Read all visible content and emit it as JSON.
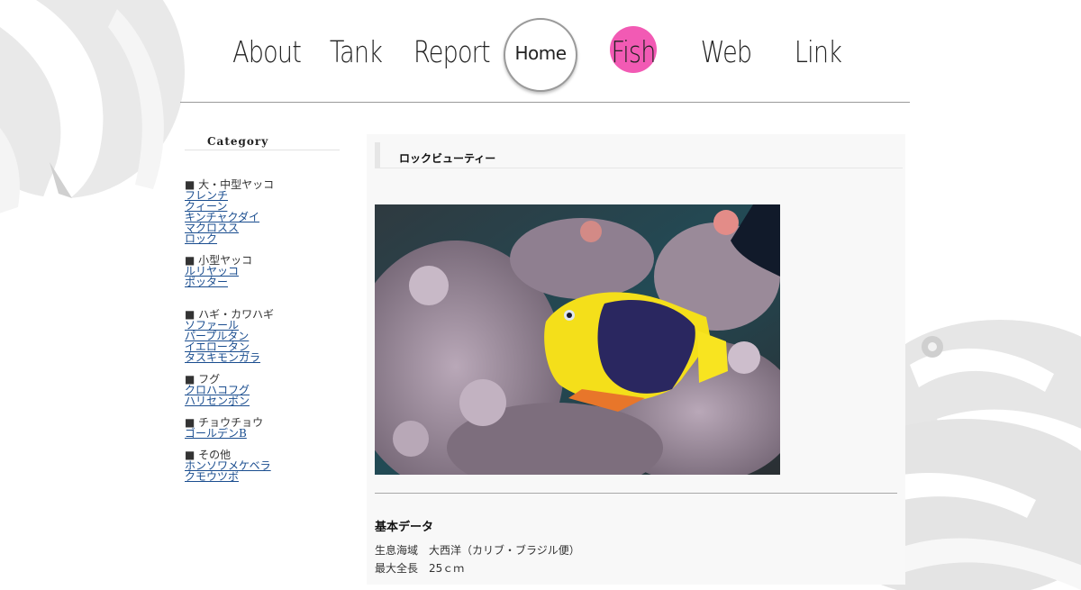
{
  "nav": {
    "items": [
      {
        "label": "About",
        "color": "#5b6ee8"
      },
      {
        "label": "Tank",
        "color": "#3fd3ee"
      },
      {
        "label": "Report",
        "color": "#3bd93b"
      },
      {
        "label": "Home",
        "color": "#9a9a9a"
      },
      {
        "label": "Fish",
        "color": "#f25ab4"
      },
      {
        "label": "Web",
        "color": "#f29a3a"
      },
      {
        "label": "Link",
        "color": "#ecea3a"
      }
    ]
  },
  "sidebar": {
    "heading": "Category",
    "groups": [
      {
        "title": "■ 大・中型ヤッコ",
        "links": [
          "フレンチ",
          "クィーン",
          "キンチャクダイ",
          "マクロスス",
          "ロック"
        ]
      },
      {
        "title": "■ 小型ヤッコ",
        "links": [
          "ルリヤッコ",
          "ポッター"
        ]
      },
      {
        "title": "■ ハギ・カワハギ",
        "links": [
          "ソファール",
          "パープルタン",
          "イエロータン",
          "タスキモンガラ"
        ]
      },
      {
        "title": "■ フグ",
        "links": [
          "クロハコフグ",
          "ハリセンボン"
        ]
      },
      {
        "title": "■ チョウチョウ",
        "links": [
          "ゴールデンB"
        ]
      },
      {
        "title": "■ その他",
        "links": [
          "ホンソワメケベラ",
          "クモウツボ"
        ]
      }
    ]
  },
  "main": {
    "title": "ロックビューティー",
    "section_heading": "基本データ",
    "data_lines": [
      "生息海域　大西洋（カリブ・ブラジル便）",
      "最大全長　25ｃｍ"
    ]
  },
  "colors": {
    "accent_fish": "#f25ab4",
    "link": "#1a4d8f"
  }
}
